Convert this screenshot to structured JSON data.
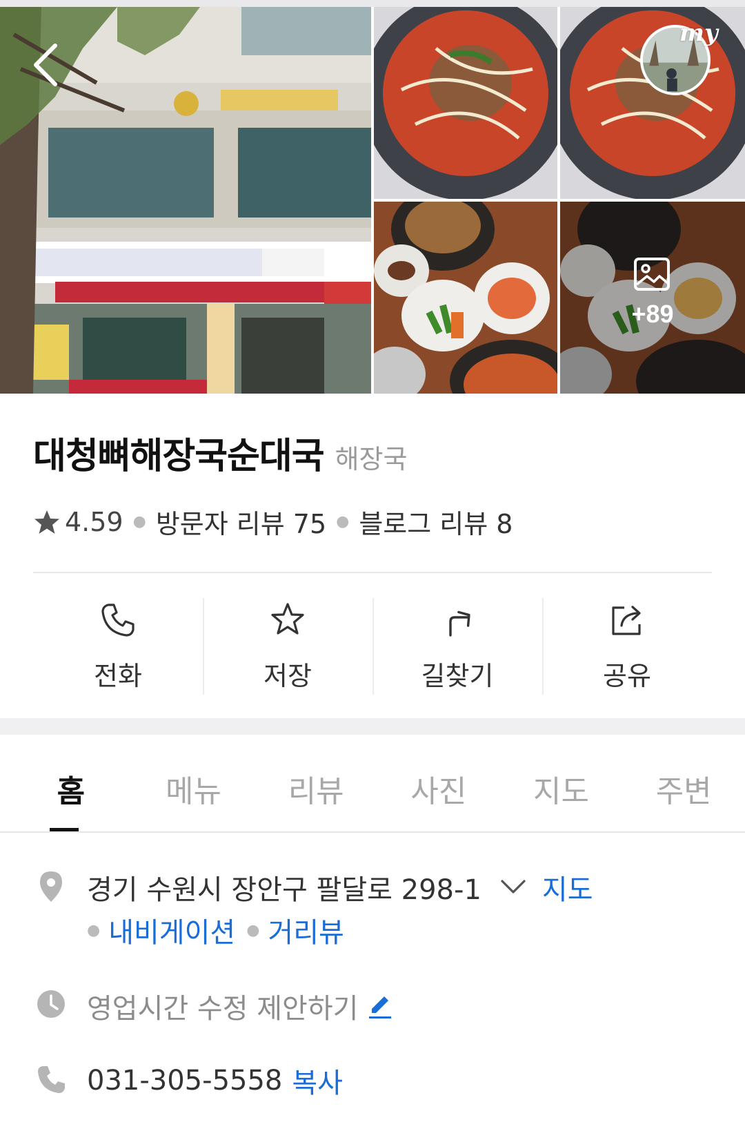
{
  "gallery": {
    "back_label": "Back",
    "my_label": "my",
    "more_count": "+89",
    "icons": {
      "back": "chevron-left-icon",
      "more": "image-icon"
    }
  },
  "place": {
    "name": "대청뼈해장국순대국",
    "category": "해장국",
    "rating": "4.59",
    "visitor_reviews": "방문자 리뷰 75",
    "blog_reviews": "블로그 리뷰 8"
  },
  "actions": [
    {
      "label": "전화",
      "icon": "phone-icon"
    },
    {
      "label": "저장",
      "icon": "star-outline-icon"
    },
    {
      "label": "길찾기",
      "icon": "directions-arrow-icon"
    },
    {
      "label": "공유",
      "icon": "share-icon"
    }
  ],
  "tabs": [
    {
      "label": "홈",
      "active": true
    },
    {
      "label": "메뉴",
      "active": false
    },
    {
      "label": "리뷰",
      "active": false
    },
    {
      "label": "사진",
      "active": false
    },
    {
      "label": "지도",
      "active": false
    },
    {
      "label": "주변",
      "active": false
    }
  ],
  "info": {
    "address": "경기 수원시 장안구 팔달로 298-1",
    "map_link": "지도",
    "navigation_link": "내비게이션",
    "street_view_link": "거리뷰",
    "hours_suggest": "영업시간 수정 제안하기",
    "phone": "031-305-5558",
    "copy_link": "복사"
  },
  "colors": {
    "link_blue": "#1a6cd6",
    "muted_gray": "#a8a8a8",
    "icon_gray": "#b5b5b5",
    "divider": "#e8e8e8"
  }
}
